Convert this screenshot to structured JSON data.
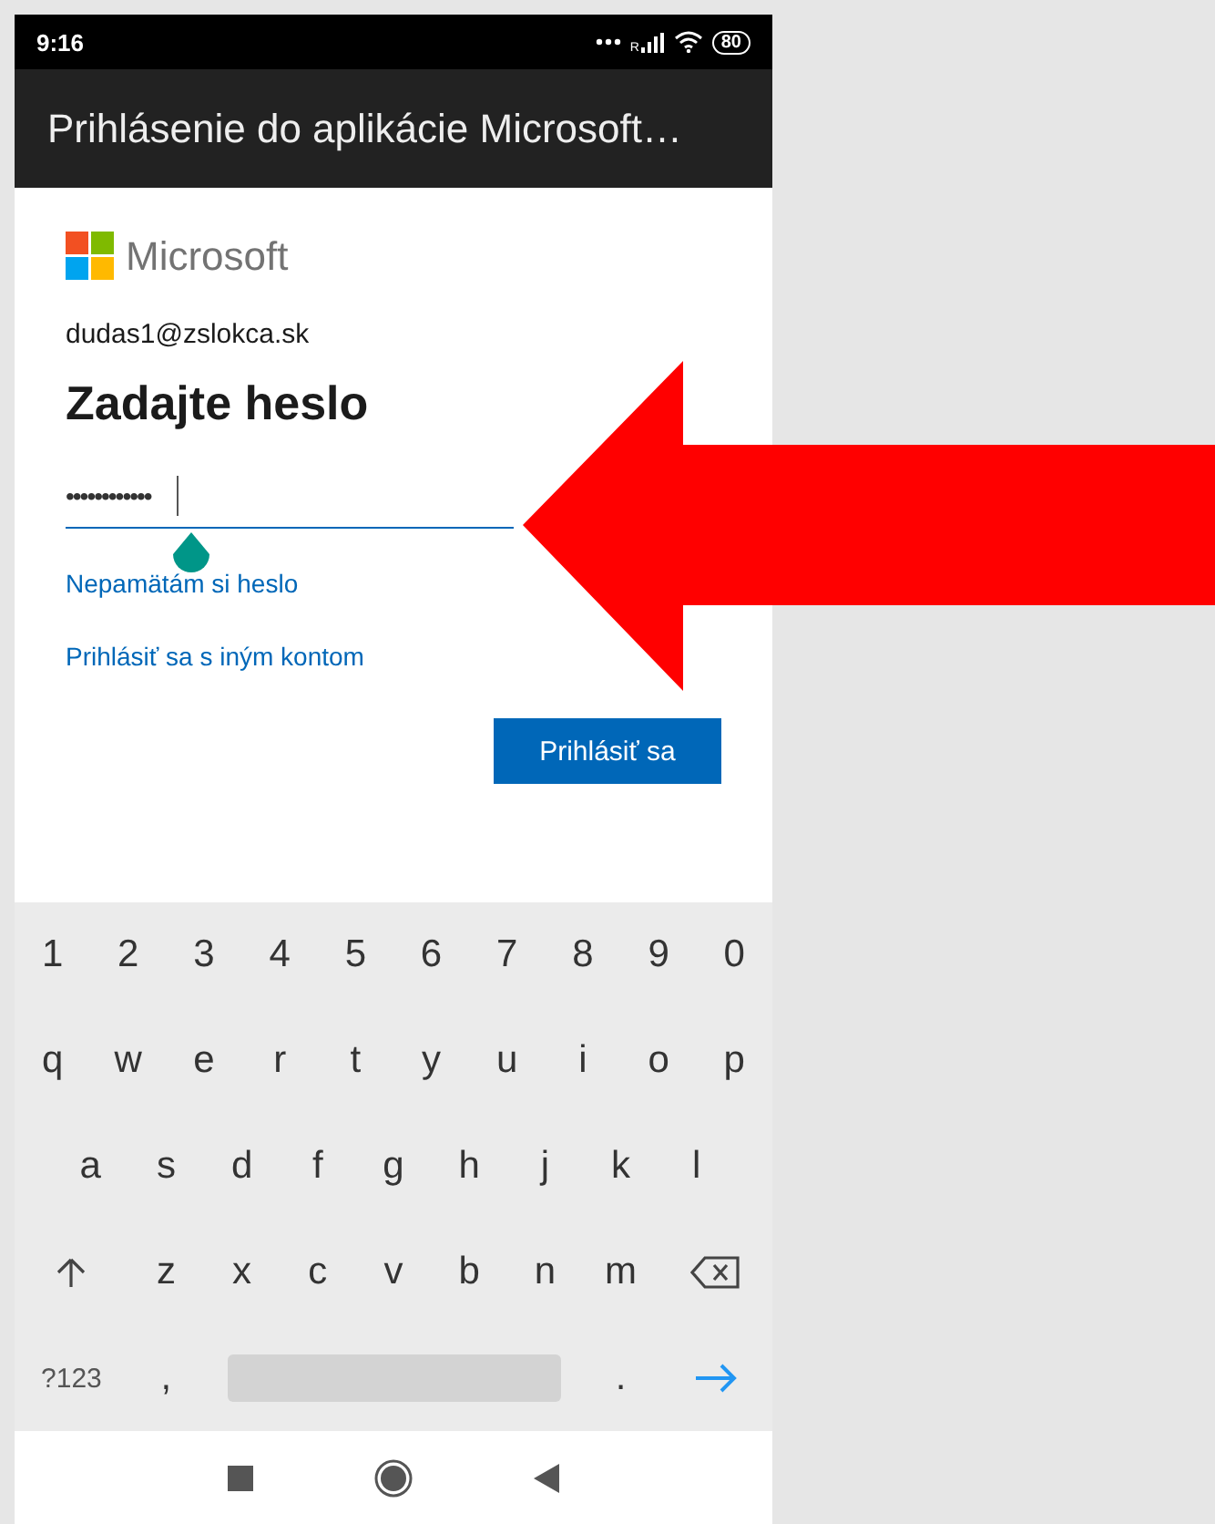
{
  "status_bar": {
    "time": "9:16",
    "signal_label": "R",
    "battery": "80"
  },
  "app_bar": {
    "title": "Prihlásenie do aplikácie Microsoft…"
  },
  "brand": {
    "name": "Microsoft"
  },
  "account": "dudas1@zslokca.sk",
  "heading": "Zadajte heslo",
  "password_field": {
    "value": "••••••••••••",
    "focused": true
  },
  "links": [
    "Nepamätám si heslo",
    "Prihlásiť sa s iným kontom"
  ],
  "buttons": [
    "Prihlásiť sa"
  ],
  "keyboard": {
    "rows": [
      [
        {
          "kind": "char",
          "label": "1"
        },
        {
          "kind": "char",
          "label": "2"
        },
        {
          "kind": "char",
          "label": "3"
        },
        {
          "kind": "char",
          "label": "4"
        },
        {
          "kind": "char",
          "label": "5"
        },
        {
          "kind": "char",
          "label": "6"
        },
        {
          "kind": "char",
          "label": "7"
        },
        {
          "kind": "char",
          "label": "8"
        },
        {
          "kind": "char",
          "label": "9"
        },
        {
          "kind": "char",
          "label": "0"
        }
      ],
      [
        {
          "kind": "char",
          "label": "q"
        },
        {
          "kind": "char",
          "label": "w"
        },
        {
          "kind": "char",
          "label": "e"
        },
        {
          "kind": "char",
          "label": "r"
        },
        {
          "kind": "char",
          "label": "t"
        },
        {
          "kind": "char",
          "label": "y"
        },
        {
          "kind": "char",
          "label": "u"
        },
        {
          "kind": "char",
          "label": "i"
        },
        {
          "kind": "char",
          "label": "o"
        },
        {
          "kind": "char",
          "label": "p"
        }
      ],
      [
        {
          "kind": "char",
          "label": "a"
        },
        {
          "kind": "char",
          "label": "s"
        },
        {
          "kind": "char",
          "label": "d"
        },
        {
          "kind": "char",
          "label": "f"
        },
        {
          "kind": "char",
          "label": "g"
        },
        {
          "kind": "char",
          "label": "h"
        },
        {
          "kind": "char",
          "label": "j"
        },
        {
          "kind": "char",
          "label": "k"
        },
        {
          "kind": "char",
          "label": "l"
        }
      ],
      [
        {
          "kind": "shift"
        },
        {
          "kind": "char",
          "label": "z"
        },
        {
          "kind": "char",
          "label": "x"
        },
        {
          "kind": "char",
          "label": "c"
        },
        {
          "kind": "char",
          "label": "v"
        },
        {
          "kind": "char",
          "label": "b"
        },
        {
          "kind": "char",
          "label": "n"
        },
        {
          "kind": "char",
          "label": "m"
        },
        {
          "kind": "backspace"
        }
      ],
      [
        {
          "kind": "symbols",
          "label": "?123"
        },
        {
          "kind": "char",
          "label": ","
        },
        {
          "kind": "space"
        },
        {
          "kind": "char",
          "label": "."
        },
        {
          "kind": "enter"
        }
      ]
    ]
  }
}
